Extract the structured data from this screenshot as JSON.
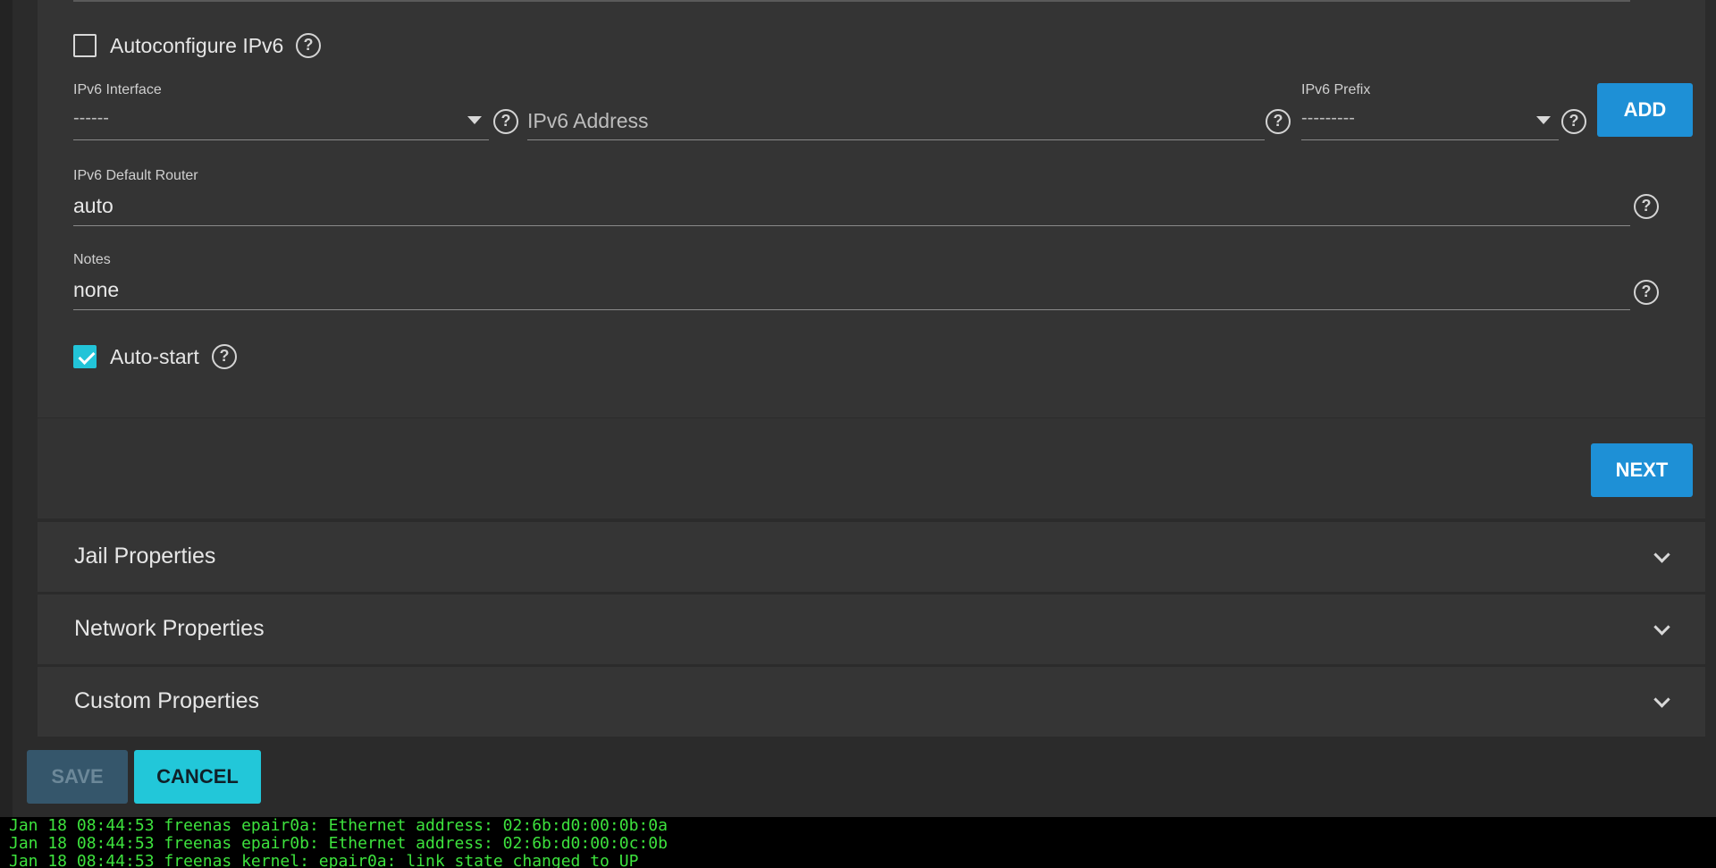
{
  "form": {
    "autoconfigure_ipv6": {
      "label": "Autoconfigure IPv6",
      "checked": false
    },
    "ipv6_interface": {
      "label": "IPv6 Interface",
      "value": "------"
    },
    "ipv6_address": {
      "placeholder": "IPv6 Address",
      "value": ""
    },
    "ipv6_prefix": {
      "label": "IPv6 Prefix",
      "value": "---------"
    },
    "add_label": "ADD",
    "ipv6_default_router": {
      "label": "IPv6 Default Router",
      "value": "auto"
    },
    "notes": {
      "label": "Notes",
      "value": "none"
    },
    "auto_start": {
      "label": "Auto-start",
      "checked": true
    },
    "next_label": "NEXT"
  },
  "panels": [
    {
      "title": "Jail Properties"
    },
    {
      "title": "Network Properties"
    },
    {
      "title": "Custom Properties"
    }
  ],
  "footer": {
    "save_label": "SAVE",
    "cancel_label": "CANCEL"
  },
  "console": {
    "lines": [
      "Jan 18 08:44:53 freenas epair0a: Ethernet address: 02:6b:d0:00:0b:0a",
      "Jan 18 08:44:53 freenas epair0b: Ethernet address: 02:6b:d0:00:0c:0b",
      "Jan 18 08:44:53 freenas kernel: epair0a: link state changed to UP"
    ]
  },
  "colors": {
    "accent_blue": "#1e90d6",
    "accent_cyan": "#22c7d9",
    "console_green": "#3de23d"
  }
}
